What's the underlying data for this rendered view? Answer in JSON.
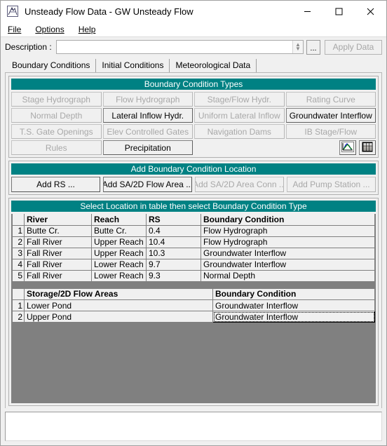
{
  "window": {
    "title": "Unsteady Flow Data - GW Unsteady Flow",
    "icon": "hec-ras-icon",
    "minimize_label": "Minimize",
    "maximize_label": "Maximize",
    "close_label": "Close"
  },
  "menubar": {
    "items": [
      {
        "label": "File",
        "accel": "F"
      },
      {
        "label": "Options",
        "accel": "O"
      },
      {
        "label": "Help",
        "accel": "H"
      }
    ]
  },
  "description": {
    "label": "Description :",
    "value": "",
    "placeholder": "",
    "browse_label": "...",
    "apply_label": "Apply Data",
    "apply_enabled": false
  },
  "tabs": [
    {
      "label": "Boundary Conditions",
      "active": true
    },
    {
      "label": "Initial Conditions",
      "active": false
    },
    {
      "label": "Meteorological Data",
      "active": false
    }
  ],
  "boundary_condition_types": {
    "header": "Boundary Condition Types",
    "buttons": [
      {
        "label": "Stage Hydrograph",
        "enabled": false
      },
      {
        "label": "Flow Hydrograph",
        "enabled": false
      },
      {
        "label": "Stage/Flow Hydr.",
        "enabled": false
      },
      {
        "label": "Rating Curve",
        "enabled": false
      },
      {
        "label": "Normal Depth",
        "enabled": false
      },
      {
        "label": "Lateral Inflow Hydr.",
        "enabled": true
      },
      {
        "label": "Uniform Lateral Inflow",
        "enabled": false
      },
      {
        "label": "Groundwater Interflow",
        "enabled": true
      },
      {
        "label": "T.S. Gate Openings",
        "enabled": false
      },
      {
        "label": "Elev Controlled Gates",
        "enabled": false
      },
      {
        "label": "Navigation Dams",
        "enabled": false
      },
      {
        "label": "IB Stage/Flow",
        "enabled": false
      },
      {
        "label": "Rules",
        "enabled": false
      },
      {
        "label": "Precipitation",
        "enabled": true
      }
    ],
    "icons": [
      {
        "name": "plot-graph-icon"
      },
      {
        "name": "table-grid-icon"
      }
    ]
  },
  "add_location": {
    "header": "Add Boundary Condition Location",
    "buttons": [
      {
        "label": "Add RS ...",
        "enabled": true
      },
      {
        "label": "Add SA/2D Flow Area ...",
        "enabled": true
      },
      {
        "label": "Add SA/2D Area Conn ...",
        "enabled": false
      },
      {
        "label": "Add Pump Station ...",
        "enabled": false
      }
    ]
  },
  "locations_table": {
    "header": "Select Location in table then select Boundary Condition Type",
    "columns": [
      "",
      "River",
      "Reach",
      "RS",
      "Boundary Condition"
    ],
    "rows": [
      {
        "n": "1",
        "river": "Butte Cr.",
        "reach": "Butte Cr.",
        "rs": "0.4",
        "bc": "Flow Hydrograph"
      },
      {
        "n": "2",
        "river": "Fall River",
        "reach": "Upper Reach",
        "rs": "10.4",
        "bc": "Flow Hydrograph"
      },
      {
        "n": "3",
        "river": "Fall River",
        "reach": "Upper Reach",
        "rs": "10.3",
        "bc": "Groundwater Interflow"
      },
      {
        "n": "4",
        "river": "Fall River",
        "reach": "Lower Reach",
        "rs": "9.7",
        "bc": "Groundwater Interflow"
      },
      {
        "n": "5",
        "river": "Fall River",
        "reach": "Lower Reach",
        "rs": "9.3",
        "bc": "Normal Depth"
      }
    ]
  },
  "storage_table": {
    "columns": [
      "",
      "Storage/2D Flow Areas",
      "Boundary Condition"
    ],
    "rows": [
      {
        "n": "1",
        "area": "Lower Pond",
        "bc": "Groundwater Interflow",
        "focused": false
      },
      {
        "n": "2",
        "area": "Upper Pond",
        "bc": "Groundwater Interflow",
        "focused": true
      }
    ]
  },
  "status_box": {
    "text": ""
  },
  "colors": {
    "teal_header": "#008183",
    "window_bg": "#f0f0f0",
    "grid_bg": "#808080",
    "disabled_text": "#a8a8a8"
  }
}
